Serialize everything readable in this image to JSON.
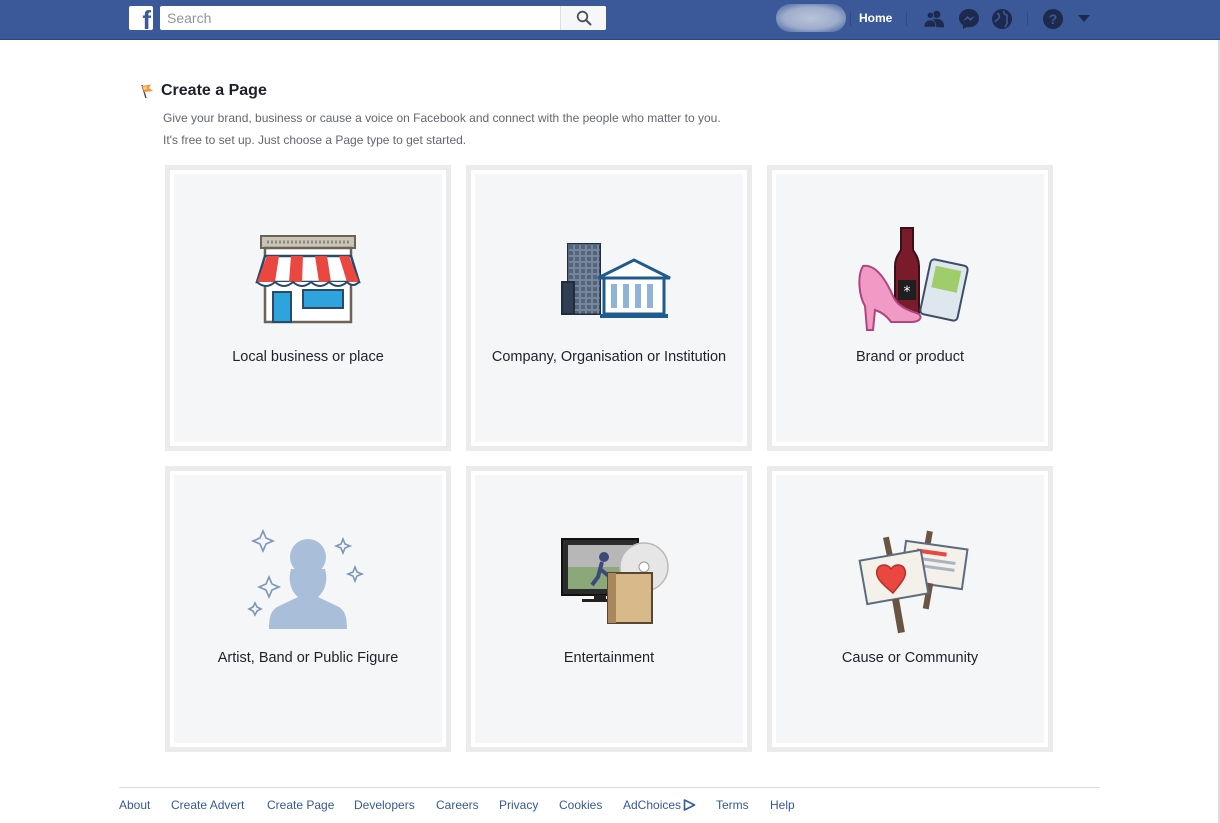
{
  "topbar": {
    "search_placeholder": "Search",
    "home_label": "Home",
    "icons": [
      "facebook-logo",
      "search-icon",
      "friend-requests-icon",
      "messenger-icon",
      "notifications-globe-icon",
      "help-icon",
      "caret-down-icon"
    ],
    "brand_color": "#3b5998"
  },
  "page": {
    "title": "Create a Page",
    "description_line1": "Give your brand, business or cause a voice on Facebook and connect with the people who matter to you.",
    "description_line2": "It's free to set up. Just choose a Page type to get started."
  },
  "cards": [
    {
      "label": "Local business or place",
      "icon": "storefront-icon"
    },
    {
      "label": "Company, Organisation or Institution",
      "icon": "company-buildings-icon"
    },
    {
      "label": "Brand or product",
      "icon": "brand-product-icon"
    },
    {
      "label": "Artist, Band or Public Figure",
      "icon": "public-figure-icon"
    },
    {
      "label": "Entertainment",
      "icon": "entertainment-icon"
    },
    {
      "label": "Cause or Community",
      "icon": "community-signs-icon"
    }
  ],
  "footer": {
    "links": [
      "About",
      "Create Advert",
      "Create Page",
      "Developers",
      "Careers",
      "Privacy",
      "Cookies",
      "AdChoices",
      "Terms",
      "Help"
    ]
  }
}
